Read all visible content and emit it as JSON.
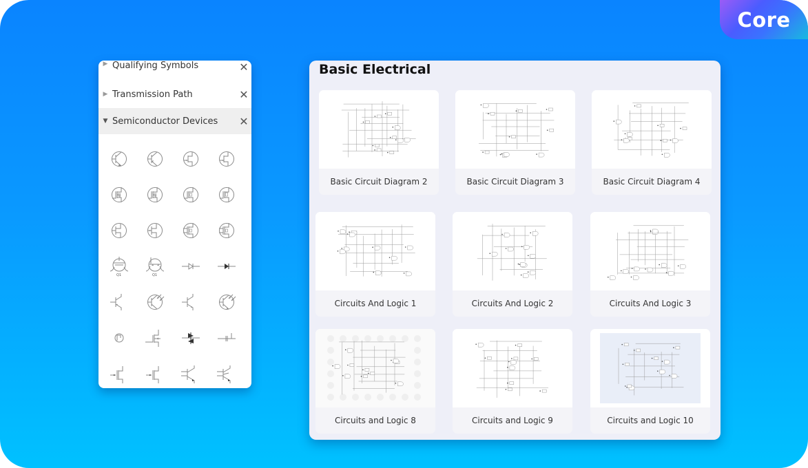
{
  "badge": {
    "label": "Core"
  },
  "library": {
    "categories": [
      {
        "label": "Qualifying Symbols",
        "expanded": false,
        "icon": "triangle-right-icon",
        "close_icon": "close-icon"
      },
      {
        "label": "Transmission Path",
        "expanded": false,
        "icon": "triangle-right-icon",
        "close_icon": "close-icon"
      },
      {
        "label": "Semiconductor Devices",
        "expanded": true,
        "icon": "triangle-down-icon",
        "close_icon": "close-icon"
      }
    ],
    "arrow_collapsed": "▶",
    "arrow_expanded": "▼",
    "close_glyph": "✕",
    "symbols": [
      "npn-transistor",
      "pnp-transistor",
      "n-jfet",
      "p-jfet",
      "n-mosfet-enh",
      "p-mosfet-enh",
      "n-mosfet-dep",
      "p-mosfet-dep",
      "n-jfet-alt",
      "p-jfet-alt",
      "n-mosfet-sub",
      "p-mosfet-sub",
      "dual-gate-mosfet-q1",
      "dual-gate-mosfet-q1-alt",
      "diode",
      "diode-filled",
      "npn-transistor-bare",
      "phototransistor",
      "pnp-transistor-bare",
      "phototransistor-alt",
      "tunnel-device",
      "igfet",
      "diac",
      "varactor",
      "n-mosfet-bare",
      "p-mosfet-bare",
      "npn-multi-emitter",
      "pnp-multi-emitter"
    ]
  },
  "templates": {
    "title": "Basic Electrical",
    "items": [
      {
        "label": "Basic Circuit Diagram 2"
      },
      {
        "label": "Basic Circuit Diagram 3"
      },
      {
        "label": "Basic Circuit Diagram 4"
      },
      {
        "label": "Circuits And Logic 1"
      },
      {
        "label": "Circuits And Logic 2"
      },
      {
        "label": "Circuits And Logic 3"
      },
      {
        "label": "Circuits and Logic 8"
      },
      {
        "label": "Circuits and Logic 9"
      },
      {
        "label": "Circuits and Logic 10"
      }
    ]
  },
  "colors": {
    "bg_top": "#0a84ff",
    "bg_bottom": "#00c1ff",
    "panel_bg": "#eeeff8",
    "card_caption_bg": "#f4f4f8",
    "active_category_bg": "#efefef"
  }
}
